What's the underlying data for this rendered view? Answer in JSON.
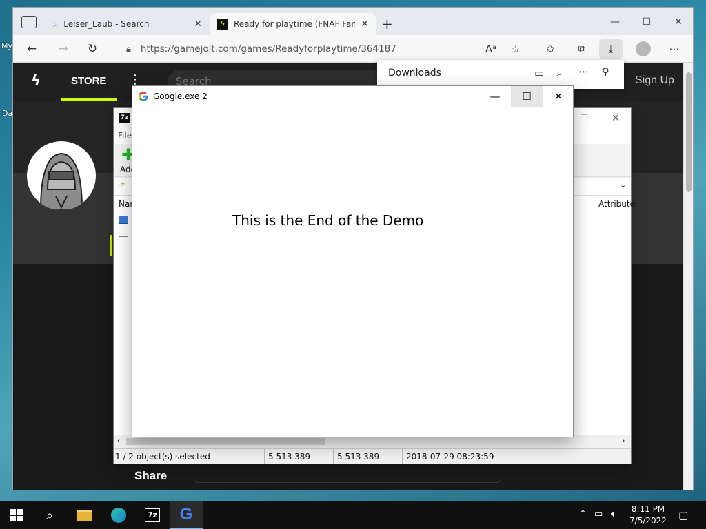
{
  "desktop": {
    "icon_label_1": "My",
    "icon_label_2": "Da"
  },
  "browser": {
    "tabs": [
      {
        "title": "Leiser_Laub - Search"
      },
      {
        "title": "Ready for playtime (FNAF Fan Ga"
      }
    ],
    "url": "https://gamejolt.com/games/Readyforplaytime/364187",
    "downloads_title": "Downloads"
  },
  "site": {
    "store_label": "STORE",
    "search_placeholder": "Search",
    "signup_label": "Sign Up",
    "share_label": "Share"
  },
  "zip": {
    "logo": "7z",
    "menu_file": "File",
    "add_label": "Add",
    "col_name": "Nar",
    "col_attributes": "Attribute",
    "status": {
      "selected": "1 / 2 object(s) selected",
      "size": "5 513 389",
      "packed": "5 513 389",
      "modified": "2018-07-29 08:23:59"
    }
  },
  "google_window": {
    "title": "Google.exe 2",
    "message": "This is the End of the Demo"
  },
  "taskbar": {
    "time": "8:11 PM",
    "date": "7/5/2022",
    "zip_label": "7z"
  },
  "colors": {
    "accent": "#ccff00",
    "taskbar": "#101010",
    "page_bg": "#191919"
  }
}
